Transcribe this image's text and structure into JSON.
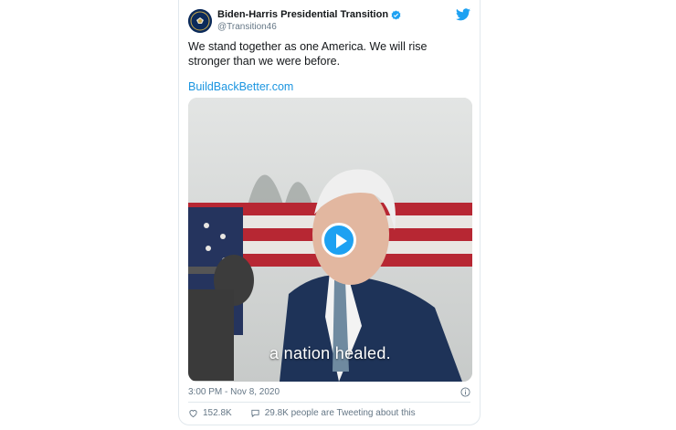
{
  "tweet": {
    "author_name": "Biden-Harris Presidential Transition",
    "handle": "@Transition46",
    "text": "We stand together as one America. We will rise stronger than we were before.",
    "link_text": "BuildBackBetter.com",
    "video_caption": "a nation healed.",
    "timestamp": "3:00 PM - Nov 8, 2020",
    "likes": "152.8K",
    "talking": "29.8K people are Tweeting about this"
  },
  "colors": {
    "accent": "#1da1f2",
    "link": "#1b95e0",
    "secondary_text": "#657786",
    "border": "#e1e8ed"
  },
  "icons": [
    "presidential-seal-avatar",
    "verified-badge-icon",
    "twitter-bird-icon",
    "play-icon",
    "info-icon",
    "heart-icon",
    "speech-bubble-icon"
  ]
}
